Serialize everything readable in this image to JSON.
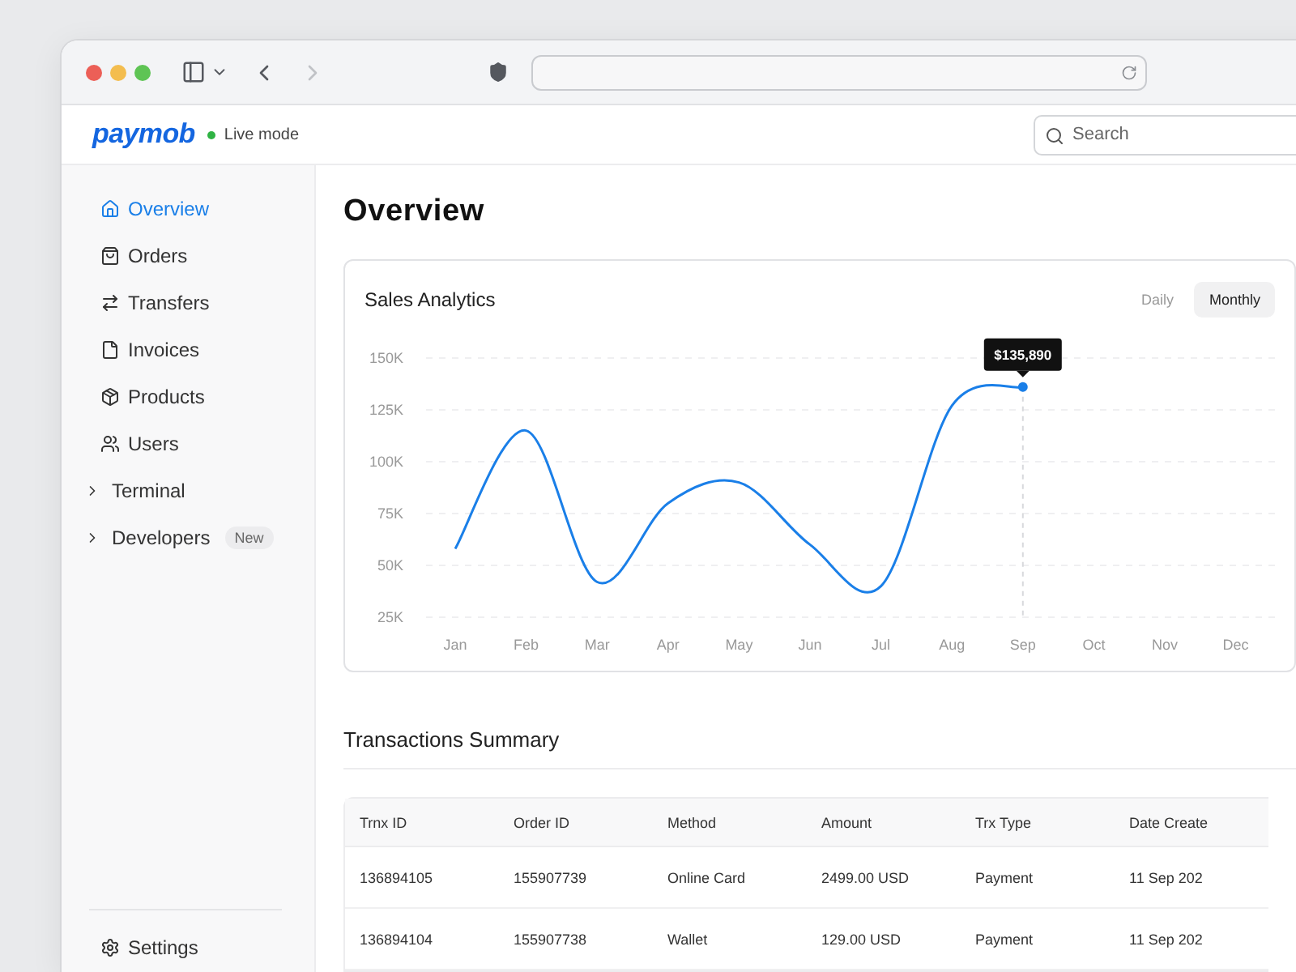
{
  "browser": {
    "nav_buttons": [
      {
        "kind": "back",
        "disabled": false
      },
      {
        "kind": "forward",
        "disabled": true
      }
    ]
  },
  "header": {
    "logo": "paymob",
    "live": true,
    "mode_label": "Live mode",
    "search": {
      "placeholder": "Search"
    }
  },
  "sidebar": {
    "items": [
      {
        "kind": "home",
        "label": "Overview",
        "selected": true
      },
      {
        "kind": "orders",
        "label": "Orders",
        "selected": false
      },
      {
        "kind": "transfers",
        "label": "Transfers",
        "selected": false
      },
      {
        "kind": "invoices",
        "label": "Invoices",
        "selected": false
      },
      {
        "kind": "products",
        "label": "Products",
        "selected": false
      },
      {
        "kind": "users",
        "label": "Users",
        "selected": false
      },
      {
        "kind": "group",
        "label": "Terminal",
        "selected": false,
        "expanded": false
      },
      {
        "kind": "group",
        "label": "Developers",
        "selected": false,
        "expanded": false,
        "badge": "New"
      }
    ],
    "footer": {
      "label": "Settings"
    }
  },
  "page_title": "Overview",
  "sales_card": {
    "title": "Sales Analytics",
    "periods": [
      {
        "label": "Daily",
        "selected": false
      },
      {
        "label": "Monthly",
        "selected": true
      }
    ],
    "chart_data": {
      "type": "line",
      "categories": [
        "Jan",
        "Feb",
        "Mar",
        "Apr",
        "May",
        "Jun",
        "Jul",
        "Aug",
        "Sep",
        "Oct",
        "Nov",
        "Dec"
      ],
      "series": [
        {
          "color": "#1a7fe8",
          "values": [
            58000,
            115000,
            42000,
            80000,
            90000,
            60000,
            40000,
            127000,
            136000,
            null,
            null,
            null
          ]
        }
      ],
      "grid": true,
      "ylim": [
        25000,
        150000
      ],
      "yticks": [
        {
          "value": 25000,
          "label": "25K"
        },
        {
          "value": 50000,
          "label": "50K"
        },
        {
          "value": 75000,
          "label": "75K"
        },
        {
          "value": 100000,
          "label": "100K"
        },
        {
          "value": 125000,
          "label": "125K"
        },
        {
          "value": 150000,
          "label": "150K"
        }
      ],
      "ref_lines": [
        {
          "axis": "x",
          "value": "Sep"
        }
      ],
      "annotations": [
        "$135,890"
      ]
    }
  },
  "transactions": {
    "title": "Transactions Summary",
    "columns": [
      "Trnx ID",
      "Order ID",
      "Method",
      "Amount",
      "Trx Type",
      "Date Create"
    ],
    "rows": [
      [
        "136894105",
        "155907739",
        "Online Card",
        "2499.00 USD",
        "Payment",
        "11 Sep 202"
      ],
      [
        "136894104",
        "155907738",
        "Wallet",
        "129.00 USD",
        "Payment",
        "11 Sep 202"
      ]
    ]
  }
}
